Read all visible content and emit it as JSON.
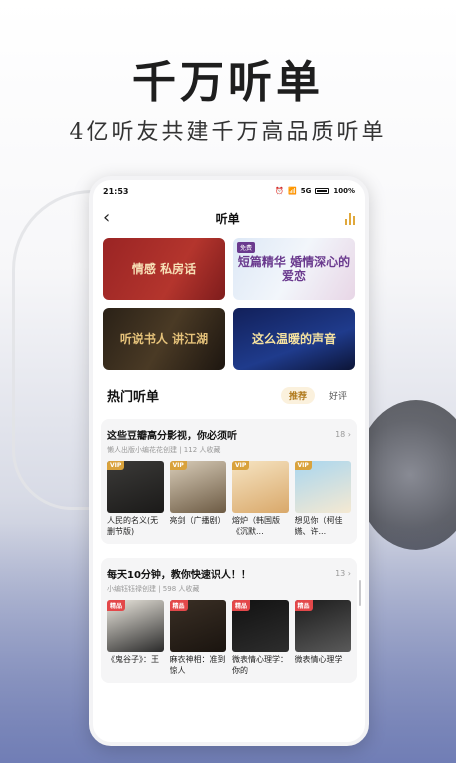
{
  "hero": {
    "title": "千万听单",
    "subtitle": "4亿听友共建千万高品质听单"
  },
  "status_bar": {
    "time": "21:53",
    "battery": "100%",
    "network": "5G"
  },
  "navbar": {
    "back_icon": "chevron-left-icon",
    "title": "听单",
    "right_icon": "audio-bars-icon",
    "accent": "#e0a83b"
  },
  "banners": [
    {
      "text": "情感 私房话",
      "tag": ""
    },
    {
      "text": "短篇精华 婚情深心的爱恋",
      "tag": "免费"
    },
    {
      "text": "听说书人 讲江湖",
      "tag": ""
    },
    {
      "text": "这么温暖的声音",
      "tag": ""
    }
  ],
  "section": {
    "title": "热门听单",
    "tabs": [
      "推荐",
      "好评"
    ],
    "active_tab": "推荐"
  },
  "cards": [
    {
      "title": "这些豆瓣高分影视，你必须听",
      "count": "18",
      "meta": "懒人出版小编花花创建 | 112 人收藏",
      "albums": [
        {
          "tag": "VIP",
          "title": "人民的名义(无删节版)"
        },
        {
          "tag": "VIP",
          "title": "亮剑（广播剧）"
        },
        {
          "tag": "VIP",
          "title": "熔炉（韩国版《沉默..."
        },
        {
          "tag": "VIP",
          "title": "想见你（柯佳嬿、许..."
        }
      ]
    },
    {
      "title": "每天10分钟，教你快速识人！！",
      "count": "13",
      "meta": "小编钰钰禄创建 | 598 人收藏",
      "albums": [
        {
          "tag": "精品",
          "title": "《鬼谷子》：王"
        },
        {
          "tag": "精品",
          "title": "麻衣神相：准到惊人"
        },
        {
          "tag": "精品",
          "title": "微表情心理学：你的"
        },
        {
          "tag": "精品",
          "title": "微表情心理学"
        }
      ]
    }
  ]
}
